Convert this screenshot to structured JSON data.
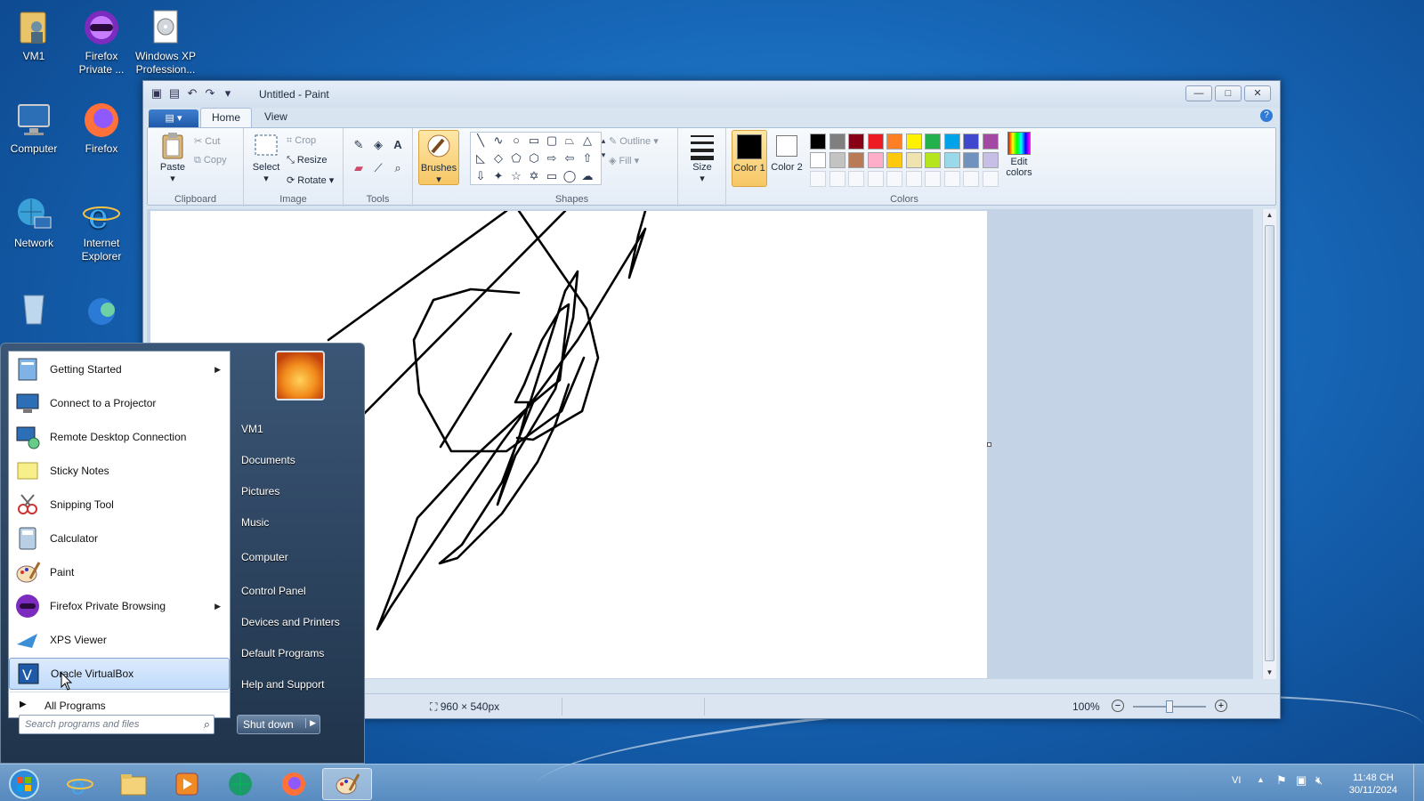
{
  "desktop": {
    "icons": [
      {
        "label": "VM1"
      },
      {
        "label": "Firefox Private ..."
      },
      {
        "label": "Windows XP Profession..."
      },
      {
        "label": "Computer"
      },
      {
        "label": "Firefox"
      },
      {
        "label": "Network"
      },
      {
        "label": "Internet Explorer"
      }
    ]
  },
  "paint": {
    "title": "Untitled - Paint",
    "tabs": [
      "Home",
      "View"
    ],
    "clipboard": {
      "group": "Clipboard",
      "paste": "Paste",
      "cut": "Cut",
      "copy": "Copy"
    },
    "image": {
      "group": "Image",
      "select": "Select",
      "crop": "Crop",
      "resize": "Resize",
      "rotate": "Rotate"
    },
    "tools": {
      "group": "Tools"
    },
    "brushes": "Brushes",
    "shapes": {
      "group": "Shapes",
      "outline": "Outline",
      "fill": "Fill"
    },
    "size": "Size",
    "color1": "Color 1",
    "color2": "Color 2",
    "colors": {
      "group": "Colors",
      "palette_row1": [
        "#000000",
        "#7f7f7f",
        "#880015",
        "#ed1c24",
        "#ff7f27",
        "#fff200",
        "#22b14c",
        "#00a2e8",
        "#3f48cc",
        "#a349a4"
      ],
      "palette_row2": [
        "#ffffff",
        "#c3c3c3",
        "#b97a57",
        "#ffaec9",
        "#ffc90e",
        "#efe4b0",
        "#b5e61d",
        "#99d9ea",
        "#7092be",
        "#c8bfe7"
      ]
    },
    "edit_colors": "Edit colors",
    "status": {
      "canvas_size": "960 × 540px",
      "zoom": "100%",
      "zoom_level": 0.5
    }
  },
  "startmenu": {
    "pinned": [
      {
        "label": "Getting Started",
        "submenu": true
      },
      {
        "label": "Connect to a Projector",
        "submenu": false
      },
      {
        "label": "Remote Desktop Connection",
        "submenu": false
      },
      {
        "label": "Sticky Notes",
        "submenu": false
      },
      {
        "label": "Snipping Tool",
        "submenu": false
      },
      {
        "label": "Calculator",
        "submenu": false
      },
      {
        "label": "Paint",
        "submenu": false
      },
      {
        "label": "Firefox Private Browsing",
        "submenu": true
      },
      {
        "label": "XPS Viewer",
        "submenu": false
      },
      {
        "label": "Oracle VirtualBox",
        "submenu": false
      }
    ],
    "all_programs": "All Programs",
    "search_placeholder": "Search programs and files",
    "right": [
      "VM1",
      "Documents",
      "Pictures",
      "Music",
      "Computer",
      "Control Panel",
      "Devices and Printers",
      "Default Programs",
      "Help and Support"
    ],
    "shutdown": "Shut down"
  },
  "taskbar": {
    "lang": "VI",
    "time": "11:48 CH",
    "date": "30/11/2024"
  }
}
